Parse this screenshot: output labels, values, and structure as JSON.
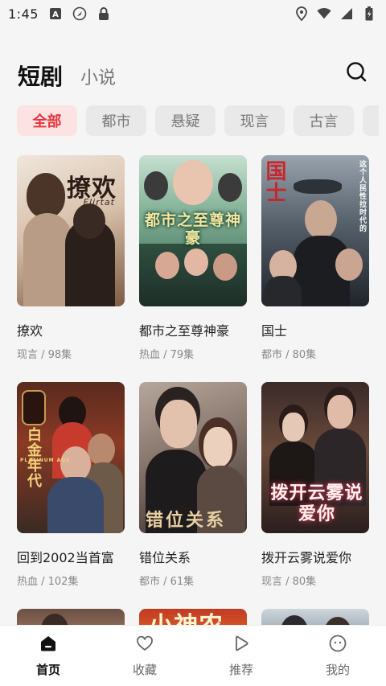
{
  "status_bar": {
    "time": "1:45",
    "left_icons": [
      "a-badge-icon",
      "navigation-icon",
      "lock-icon"
    ],
    "right_icons": [
      "location-icon",
      "wifi-icon",
      "signal-icon",
      "battery-icon"
    ]
  },
  "header": {
    "active_tab": "短剧",
    "inactive_tab": "小说",
    "search_icon": "search-icon"
  },
  "filters": [
    {
      "label": "全部",
      "active": true
    },
    {
      "label": "都市",
      "active": false
    },
    {
      "label": "悬疑",
      "active": false
    },
    {
      "label": "现言",
      "active": false
    },
    {
      "label": "古言",
      "active": false
    }
  ],
  "dramas": [
    {
      "title": "撩欢",
      "meta": "现言 / 98集",
      "poster_text": "撩欢",
      "poster_sub": "Flirtat"
    },
    {
      "title": "都市之至尊神豪",
      "meta": "热血 / 79集",
      "poster_text": "都市之至尊神豪",
      "poster_sub": ""
    },
    {
      "title": "国士",
      "meta": "都市 / 80集",
      "poster_text": "国士",
      "poster_sub": "这个人民性拉时代的"
    },
    {
      "title": "回到2002当首富",
      "meta": "热血 / 102集",
      "poster_text": "白金年代",
      "poster_sub": "PLATINUM AGE"
    },
    {
      "title": "错位关系",
      "meta": "都市 / 61集",
      "poster_text": "错位关系",
      "poster_sub": ""
    },
    {
      "title": "拨开云雾说爱你",
      "meta": "现言 / 80集",
      "poster_text": "拨开云雾说爱你",
      "poster_sub": ""
    },
    {
      "title": "",
      "meta": "",
      "poster_text": "",
      "poster_sub": ""
    },
    {
      "title": "",
      "meta": "",
      "poster_text": "小神农",
      "poster_sub": ""
    },
    {
      "title": "",
      "meta": "",
      "poster_text": "",
      "poster_sub": ""
    }
  ],
  "bottom_nav": [
    {
      "label": "首页",
      "icon": "home-icon",
      "active": true
    },
    {
      "label": "收藏",
      "icon": "heart-icon",
      "active": false
    },
    {
      "label": "推荐",
      "icon": "play-icon",
      "active": false
    },
    {
      "label": "我的",
      "icon": "smile-icon",
      "active": false
    }
  ],
  "colors": {
    "accent": "#e8323c",
    "chip_active_bg": "#fbe3e3",
    "chip_bg": "#e9e9e9",
    "background": "#f5f5f5"
  }
}
